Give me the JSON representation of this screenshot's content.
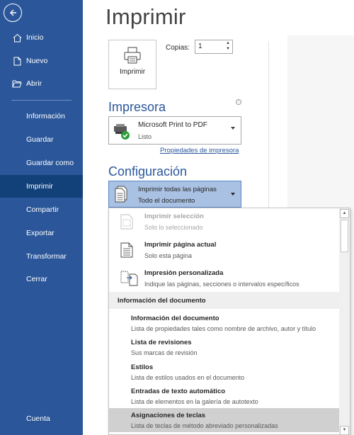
{
  "sidebar": {
    "items": [
      {
        "label": "Inicio",
        "icon": "home-icon"
      },
      {
        "label": "Nuevo",
        "icon": "new-document-icon"
      },
      {
        "label": "Abrir",
        "icon": "folder-open-icon"
      },
      {
        "label": "Información"
      },
      {
        "label": "Guardar"
      },
      {
        "label": "Guardar como"
      },
      {
        "label": "Imprimir",
        "active": true
      },
      {
        "label": "Compartir"
      },
      {
        "label": "Exportar"
      },
      {
        "label": "Transformar"
      },
      {
        "label": "Cerrar"
      },
      {
        "label": "Cuenta"
      }
    ],
    "accent_color": "#2b579a",
    "active_color": "#124078"
  },
  "page": {
    "title": "Imprimir"
  },
  "print_button": {
    "label": "Imprimir"
  },
  "copies": {
    "label": "Copias:",
    "value": "1"
  },
  "printer": {
    "heading": "Impresora",
    "name": "Microsoft Print to PDF",
    "status": "Listo",
    "properties_link": "Propiedades de impresora"
  },
  "settings": {
    "heading": "Configuración",
    "selected_title": "Imprimir todas las páginas",
    "selected_subtitle": "Todo el documento"
  },
  "menu": {
    "items": [
      {
        "title": "Imprimir selección",
        "subtitle": "Solo lo seleccionado",
        "disabled": true
      },
      {
        "title": "Imprimir página actual",
        "subtitle": "Solo esta página"
      },
      {
        "title": "Impresión personalizada",
        "subtitle": "Indique las páginas, secciones o intervalos específicos"
      }
    ],
    "section_header": "Información del documento",
    "sub_items": [
      {
        "title": "Información del documento",
        "subtitle": "Lista de propiedades tales como nombre de archivo, autor y título"
      },
      {
        "title": "Lista de revisiones",
        "subtitle": "Sus marcas de revisión"
      },
      {
        "title": "Estilos",
        "subtitle": "Lista de estilos usados en el documento"
      },
      {
        "title": "Entradas de texto automático",
        "subtitle": "Lista de elementos en la galería de autotexto"
      },
      {
        "title": "Asignaciones de teclas",
        "subtitle": "Lista de teclas de método abreviado personalizadas",
        "highlighted": true
      }
    ]
  }
}
